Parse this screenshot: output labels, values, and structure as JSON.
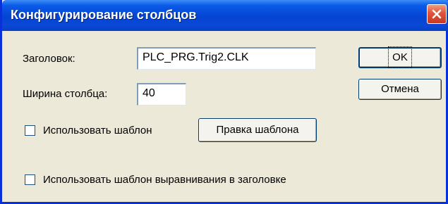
{
  "window": {
    "title": "Конфигурирование столбцов"
  },
  "form": {
    "header_label": "Заголовок:",
    "header_value": "PLC_PRG.Trig2.CLK",
    "width_label": "Ширина столбца:",
    "width_value": "40",
    "use_template_label": "Использовать шаблон",
    "use_template_checked": false,
    "edit_template_label": "Правка шаблона",
    "use_align_template_label": "Использовать шаблон выравнивания в заголовке",
    "use_align_template_checked": false
  },
  "buttons": {
    "ok_label": "OK",
    "cancel_label": "Отмена"
  },
  "icons": {
    "close": "close-icon"
  },
  "colors": {
    "titlebar": "#0544d3",
    "face": "#ece9d8",
    "close": "#e2533a"
  }
}
